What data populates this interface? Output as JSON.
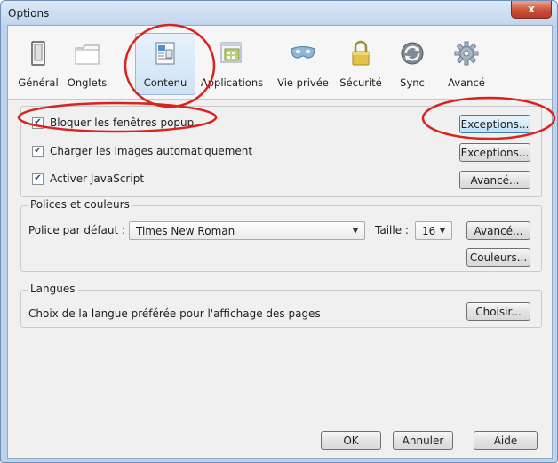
{
  "window": {
    "title": "Options",
    "close_glyph": "x"
  },
  "toolbar": {
    "items": [
      {
        "label": "Général",
        "icon": "general-switch-icon"
      },
      {
        "label": "Onglets",
        "icon": "tabs-icon"
      },
      {
        "label": "Contenu",
        "icon": "content-page-icon",
        "selected": true
      },
      {
        "label": "Applications",
        "icon": "applications-icon"
      },
      {
        "label": "Vie privée",
        "icon": "privacy-mask-icon"
      },
      {
        "label": "Sécurité",
        "icon": "security-lock-icon"
      },
      {
        "label": "Sync",
        "icon": "sync-icon"
      },
      {
        "label": "Avancé",
        "icon": "advanced-gear-icon"
      }
    ]
  },
  "content": {
    "popup": {
      "label": "Bloquer les fenêtres popup",
      "checked": true,
      "button": "Exceptions..."
    },
    "images": {
      "label": "Charger les images automatiquement",
      "checked": true,
      "button": "Exceptions..."
    },
    "javascript": {
      "label": "Activer JavaScript",
      "checked": true,
      "button": "Avancé..."
    }
  },
  "fonts": {
    "title": "Polices et couleurs",
    "default_font_label": "Police par défaut :",
    "default_font_value": "Times New Roman",
    "size_label": "Taille :",
    "size_value": "16",
    "advanced_button": "Avancé...",
    "colors_button": "Couleurs..."
  },
  "languages": {
    "title": "Langues",
    "description": "Choix de la langue préférée pour l'affichage des pages",
    "choose_button": "Choisir..."
  },
  "footer": {
    "ok": "OK",
    "cancel": "Annuler",
    "help": "Aide"
  },
  "colors": {
    "annotation_red": "#d8231f",
    "selected_tab": "#cfe3f6",
    "close_red": "#c9513a"
  }
}
